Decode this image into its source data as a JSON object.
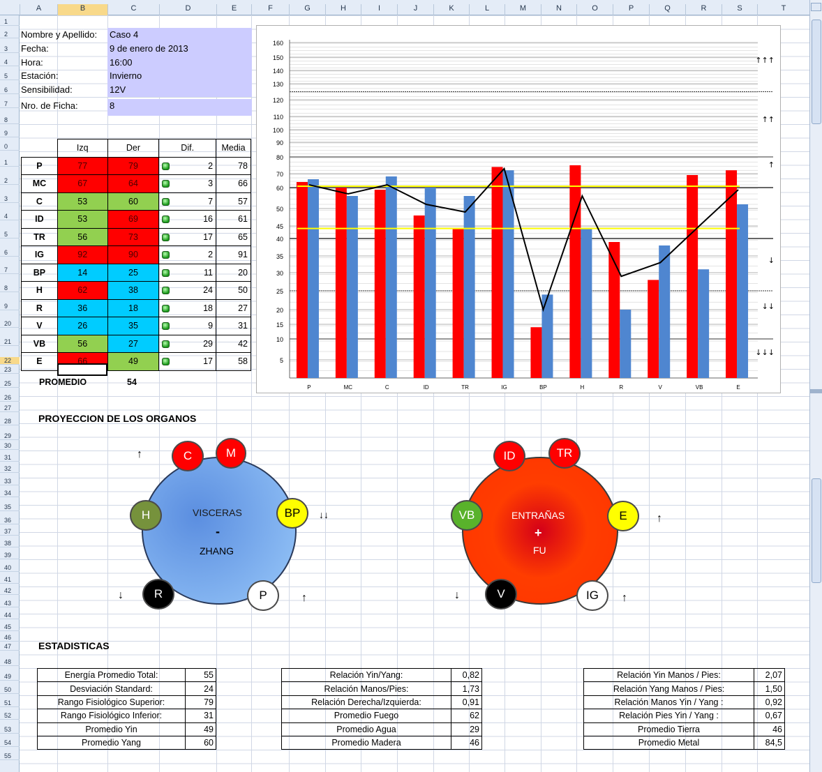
{
  "columns": [
    "A",
    "B",
    "C",
    "D",
    "E",
    "F",
    "G",
    "H",
    "I",
    "J",
    "K",
    "L",
    "M",
    "N",
    "O",
    "P",
    "Q",
    "R",
    "S",
    "T"
  ],
  "rows": [
    "1",
    "2",
    "3",
    "4",
    "5",
    "6",
    "7",
    "8",
    "9",
    "0",
    "1",
    "2",
    "3",
    "4",
    "5",
    "6",
    "7",
    "8",
    "9",
    "20",
    "21",
    "22",
    "23",
    "25",
    "26",
    "27",
    "28",
    "29",
    "30",
    "31",
    "32",
    "33",
    "34",
    "35",
    "36",
    "37",
    "38",
    "39",
    "40",
    "41",
    "42",
    "43",
    "44",
    "45",
    "46",
    "47",
    "48",
    "49",
    "50",
    "51",
    "52",
    "53",
    "54",
    "55"
  ],
  "info": [
    {
      "label": "Nombre y Apellido:",
      "value": "Caso 4"
    },
    {
      "label": "Fecha:",
      "value": "9 de enero de 2013"
    },
    {
      "label": "Hora:",
      "value": "16:00"
    },
    {
      "label": "Estación:",
      "value": "Invierno"
    },
    {
      "label": "Sensibilidad:",
      "value": "12V"
    },
    {
      "label": "Nro. de Ficha:",
      "value": "8"
    }
  ],
  "table": {
    "headers": [
      "",
      "Izq",
      "Der",
      "Dif.",
      "Media"
    ],
    "rows": [
      {
        "name": "P",
        "izq": "77",
        "der": "79",
        "dif": "2",
        "media": "78",
        "ci": "red",
        "cd": "red"
      },
      {
        "name": "MC",
        "izq": "67",
        "der": "64",
        "dif": "3",
        "media": "66",
        "ci": "red",
        "cd": "red"
      },
      {
        "name": "C",
        "izq": "53",
        "der": "60",
        "dif": "7",
        "media": "57",
        "ci": "grn",
        "cd": "grn"
      },
      {
        "name": "ID",
        "izq": "53",
        "der": "69",
        "dif": "16",
        "media": "61",
        "ci": "grn",
        "cd": "red"
      },
      {
        "name": "TR",
        "izq": "56",
        "der": "73",
        "dif": "17",
        "media": "65",
        "ci": "grn",
        "cd": "red"
      },
      {
        "name": "IG",
        "izq": "92",
        "der": "90",
        "dif": "2",
        "media": "91",
        "ci": "red",
        "cd": "red"
      },
      {
        "name": "BP",
        "izq": "14",
        "der": "25",
        "dif": "11",
        "media": "20",
        "ci": "cyn",
        "cd": "cyn"
      },
      {
        "name": "H",
        "izq": "62",
        "der": "38",
        "dif": "24",
        "media": "50",
        "ci": "red",
        "cd": "cyn"
      },
      {
        "name": "R",
        "izq": "36",
        "der": "18",
        "dif": "18",
        "media": "27",
        "ci": "cyn",
        "cd": "cyn"
      },
      {
        "name": "V",
        "izq": "26",
        "der": "35",
        "dif": "9",
        "media": "31",
        "ci": "cyn",
        "cd": "cyn"
      },
      {
        "name": "VB",
        "izq": "56",
        "der": "27",
        "dif": "29",
        "media": "42",
        "ci": "grn",
        "cd": "cyn"
      },
      {
        "name": "E",
        "izq": "66",
        "der": "49",
        "dif": "17",
        "media": "58",
        "ci": "red",
        "cd": "grn"
      }
    ],
    "promedio_label": "PROMEDIO",
    "promedio_value": "54"
  },
  "chart_data": {
    "type": "bar",
    "categories": [
      "P",
      "MC",
      "C",
      "ID",
      "TR",
      "IG",
      "BP",
      "H",
      "R",
      "V",
      "VB",
      "E"
    ],
    "series": [
      {
        "name": "",
        "color": "#ff0000",
        "values": [
          64,
          60,
          59,
          48,
          44,
          74,
          14,
          75,
          39,
          28,
          69,
          72
        ]
      },
      {
        "name": "",
        "color": "#4f86d0",
        "values": [
          66,
          56,
          68,
          60,
          56,
          72,
          24,
          44,
          20,
          38,
          31,
          52
        ]
      },
      {
        "name": "",
        "color": "#000000",
        "type": "line",
        "values": [
          62,
          57,
          62,
          52,
          49,
          73,
          20,
          56,
          29,
          33,
          45,
          59
        ]
      }
    ],
    "yticks": [
      "160",
      "150",
      "140",
      "130",
      "120",
      "110",
      "100",
      "90",
      "80",
      "70",
      "60",
      "50",
      "45",
      "40",
      "35",
      "30",
      "25",
      "20",
      "15",
      "10",
      "5"
    ],
    "yellow_lines": [
      61,
      44
    ],
    "side_arrows": [
      "↑↑↑",
      "↑↑",
      "↑",
      "↓",
      "↓↓",
      "↓↓↓"
    ]
  },
  "organs": {
    "title": "PROYECCION DE LOS ORGANOS",
    "left": {
      "line1": "VISCERAS",
      "line2": "-",
      "line3": "ZHANG",
      "bubbles": {
        "C": "C",
        "M": "M",
        "BP": "BP",
        "P": "P",
        "R": "R",
        "H": "H"
      },
      "arrows": {
        "top": "↑",
        "bp": "↓↓",
        "p": "↑",
        "r": "↓"
      }
    },
    "right": {
      "line1": "ENTRAÑAS",
      "line2": "+",
      "line3": "FU",
      "bubbles": {
        "ID": "ID",
        "TR": "TR",
        "E": "E",
        "IG": "IG",
        "V": "V",
        "VB": "VB"
      },
      "arrows": {
        "e": "↑",
        "ig": "↑",
        "v": "↓"
      }
    }
  },
  "stats": {
    "title": "ESTADISTICAS",
    "t1": [
      {
        "k": "Energía Promedio Total:",
        "v": "55"
      },
      {
        "k": "Desviación Standard:",
        "v": "24"
      },
      {
        "k": "Rango Fisiológico Superior:",
        "v": "79"
      },
      {
        "k": "Rango Fisiológico Inferior:",
        "v": "31"
      },
      {
        "k": "Promedio Yin",
        "v": "49"
      },
      {
        "k": "Promedio Yang",
        "v": "60"
      }
    ],
    "t2": [
      {
        "k": "Relación Yin/Yang:",
        "v": "0,82"
      },
      {
        "k": "Relación Manos/Pies:",
        "v": "1,73"
      },
      {
        "k": "Relación Derecha/Izquierda:",
        "v": "0,91"
      },
      {
        "k": "Promedio Fuego",
        "v": "62"
      },
      {
        "k": "Promedio Agua",
        "v": "29"
      },
      {
        "k": "Promedio Madera",
        "v": "46"
      }
    ],
    "t3": [
      {
        "k": "Relación Yin Manos / Pies:",
        "v": "2,07"
      },
      {
        "k": "Relación Yang Manos / Pies:",
        "v": "1,50"
      },
      {
        "k": "Relación Manos Yin / Yang :",
        "v": "0,92"
      },
      {
        "k": "Relación Pies Yin / Yang :",
        "v": "0,67"
      },
      {
        "k": "Promedio Tierra",
        "v": "46"
      },
      {
        "k": "Promedio Metal",
        "v": "84,5"
      }
    ]
  }
}
